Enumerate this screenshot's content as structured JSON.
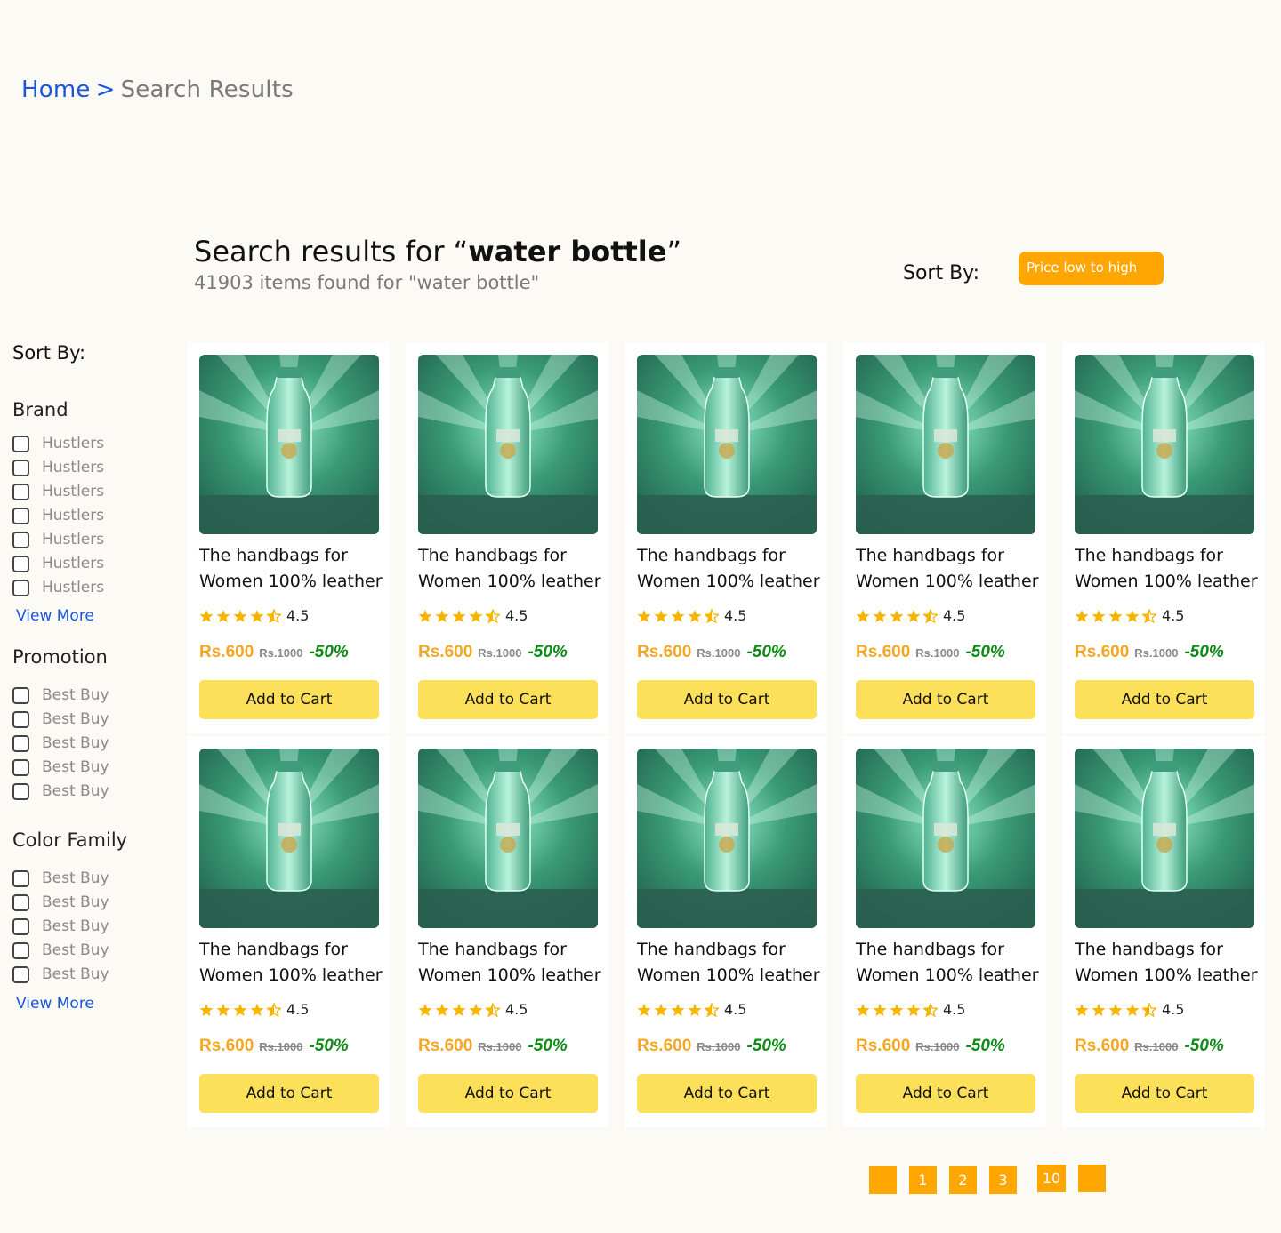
{
  "breadcrumb": {
    "home": "Home",
    "separator": ">",
    "current": "Search Results"
  },
  "search": {
    "title_prefix": "Search results for “",
    "query": "water bottle",
    "title_suffix": "”",
    "count_text": "41903 items found for \"water bottle\"",
    "sort_label": "Sort By:",
    "sort_value": "Price low to high"
  },
  "sidebar": {
    "title": "Sort By:",
    "brand": {
      "heading": "Brand",
      "items": [
        "Hustlers",
        "Hustlers",
        "Hustlers",
        "Hustlers",
        "Hustlers",
        "Hustlers",
        "Hustlers"
      ],
      "view_more": "View More"
    },
    "promotion": {
      "heading": "Promotion",
      "items": [
        "Best Buy",
        "Best Buy",
        "Best Buy",
        "Best Buy",
        "Best Buy"
      ]
    },
    "color_family": {
      "heading": "Color Family",
      "items": [
        "Best Buy",
        "Best Buy",
        "Best Buy",
        "Best Buy",
        "Best Buy"
      ],
      "view_more": "View More"
    }
  },
  "products": [
    {
      "name_line1": "The handbags for",
      "name_line2": "Women 100% leather",
      "rating": 4.5,
      "rating_text": "4.5",
      "price": "Rs.600",
      "old_price": "Rs.1000",
      "discount": "-50%",
      "button": "Add to Cart"
    },
    {
      "name_line1": "The handbags for",
      "name_line2": "Women 100% leather",
      "rating": 4.5,
      "rating_text": "4.5",
      "price": "Rs.600",
      "old_price": "Rs.1000",
      "discount": "-50%",
      "button": "Add to Cart"
    },
    {
      "name_line1": "The handbags for",
      "name_line2": "Women 100% leather",
      "rating": 4.5,
      "rating_text": "4.5",
      "price": "Rs.600",
      "old_price": "Rs.1000",
      "discount": "-50%",
      "button": "Add to Cart"
    },
    {
      "name_line1": "The handbags for",
      "name_line2": "Women 100% leather",
      "rating": 4.5,
      "rating_text": "4.5",
      "price": "Rs.600",
      "old_price": "Rs.1000",
      "discount": "-50%",
      "button": "Add to Cart"
    },
    {
      "name_line1": "The handbags for",
      "name_line2": "Women 100% leather",
      "rating": 4.5,
      "rating_text": "4.5",
      "price": "Rs.600",
      "old_price": "Rs.1000",
      "discount": "-50%",
      "button": "Add to Cart"
    },
    {
      "name_line1": "The handbags for",
      "name_line2": "Women 100% leather",
      "rating": 4.5,
      "rating_text": "4.5",
      "price": "Rs.600",
      "old_price": "Rs.1000",
      "discount": "-50%",
      "button": "Add to Cart"
    },
    {
      "name_line1": "The handbags for",
      "name_line2": "Women 100% leather",
      "rating": 4.5,
      "rating_text": "4.5",
      "price": "Rs.600",
      "old_price": "Rs.1000",
      "discount": "-50%",
      "button": "Add to Cart"
    },
    {
      "name_line1": "The handbags for",
      "name_line2": "Women 100% leather",
      "rating": 4.5,
      "rating_text": "4.5",
      "price": "Rs.600",
      "old_price": "Rs.1000",
      "discount": "-50%",
      "button": "Add to Cart"
    },
    {
      "name_line1": "The handbags for",
      "name_line2": "Women 100% leather",
      "rating": 4.5,
      "rating_text": "4.5",
      "price": "Rs.600",
      "old_price": "Rs.1000",
      "discount": "-50%",
      "button": "Add to Cart"
    },
    {
      "name_line1": "The handbags for",
      "name_line2": "Women 100% leather",
      "rating": 4.5,
      "rating_text": "4.5",
      "price": "Rs.600",
      "old_price": "Rs.1000",
      "discount": "-50%",
      "button": "Add to Cart"
    }
  ],
  "pagination": {
    "prev_icon": "chevron-left-icon",
    "pages": [
      "1",
      "2",
      "3",
      "10"
    ],
    "next_icon": "chevron-right-icon"
  },
  "colors": {
    "accent_orange": "#ffa600",
    "button_yellow": "#fde05a",
    "price_orange": "#f5a623",
    "discount_green": "#0e8a16",
    "link_blue": "#1a56db",
    "star_gold": "#f7b500"
  }
}
